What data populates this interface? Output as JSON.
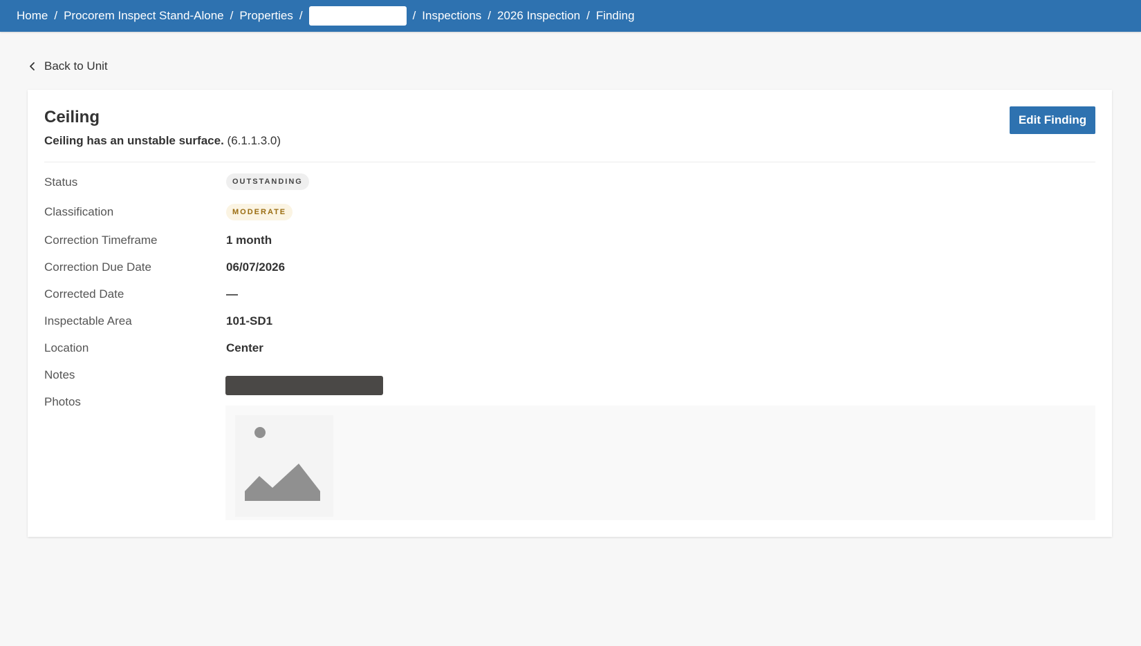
{
  "breadcrumb": {
    "items": [
      "Home",
      "Procorem Inspect Stand-Alone",
      "Properties",
      "Inspections",
      "2026 Inspection",
      "Finding"
    ],
    "separator": "/"
  },
  "back_link": {
    "label": "Back to Unit",
    "icon": "chevron-left-icon"
  },
  "finding": {
    "title": "Ceiling",
    "description": "Ceiling has an unstable surface.",
    "code": "(6.1.1.3.0)",
    "edit_button_label": "Edit Finding"
  },
  "details": {
    "status_label": "Status",
    "status_value": "OUTSTANDING",
    "classification_label": "Classification",
    "classification_value": "MODERATE",
    "correction_timeframe_label": "Correction Timeframe",
    "correction_timeframe_value": "1 month",
    "correction_due_date_label": "Correction Due Date",
    "correction_due_date_value": "06/07/2026",
    "corrected_date_label": "Corrected Date",
    "corrected_date_value": "—",
    "inspectable_area_label": "Inspectable Area",
    "inspectable_area_value": "101-SD1",
    "location_label": "Location",
    "location_value": "Center",
    "notes_label": "Notes",
    "photos_label": "Photos",
    "photo_placeholder_icon": "image-placeholder-icon"
  },
  "colors": {
    "brand_blue": "#2e72b0",
    "page_background": "#f7f7f7",
    "status_badge_bg": "#efefef",
    "moderate_badge_bg": "#fbf4e3",
    "moderate_badge_text": "#9a6d12"
  }
}
